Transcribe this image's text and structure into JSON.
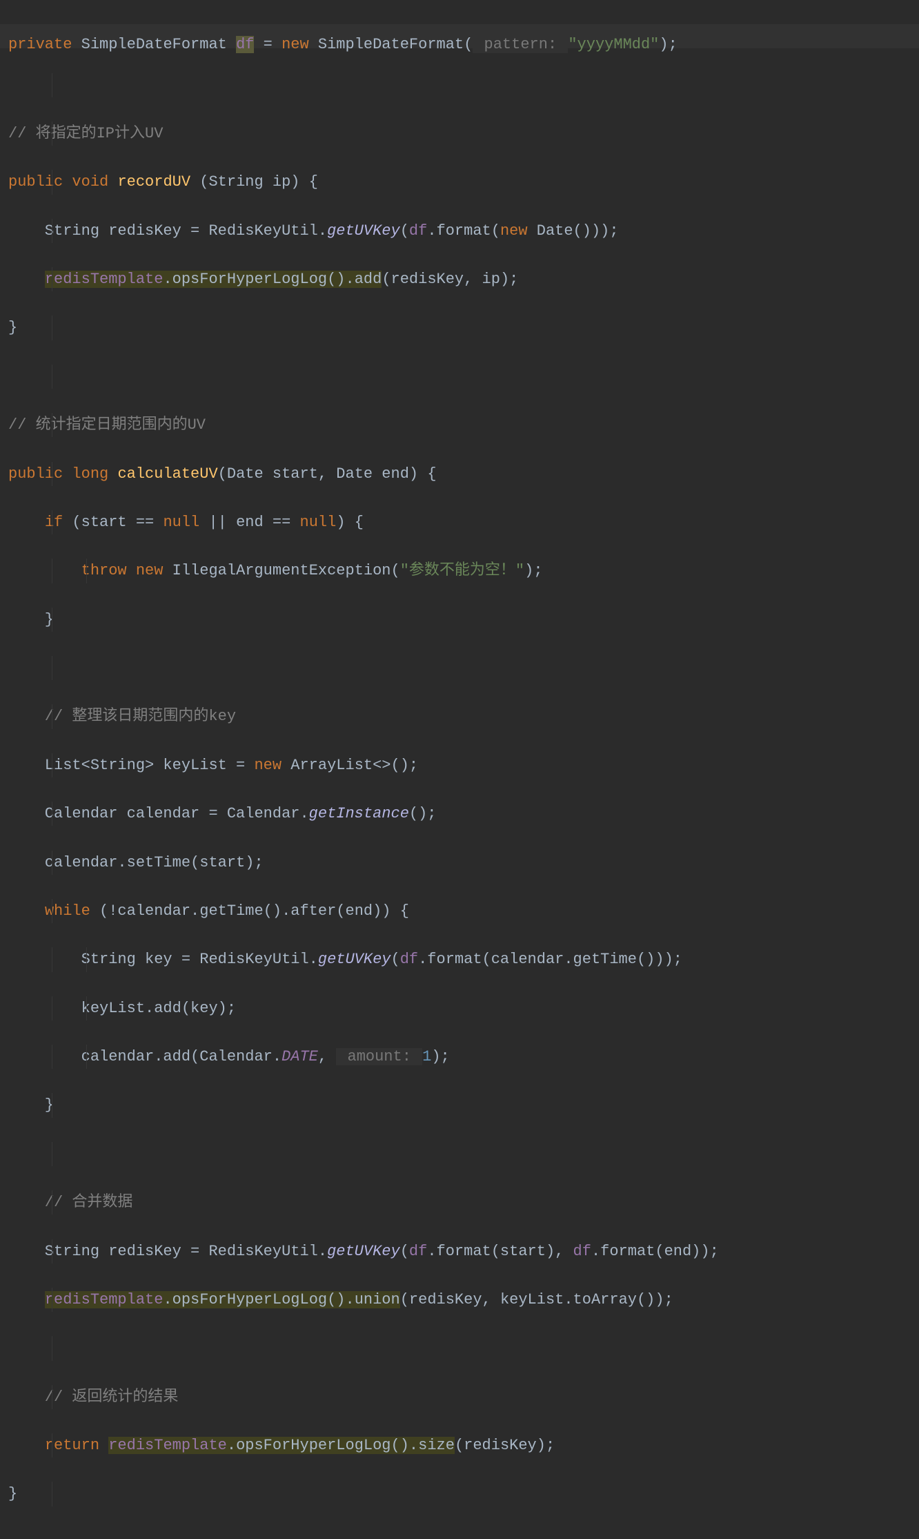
{
  "code": {
    "line1": {
      "kw1": "private",
      "type1": "SimpleDateFormat",
      "field": "df",
      "eq": " = ",
      "kw2": "new",
      "type2": "SimpleDateFormat(",
      "hint": " pattern: ",
      "str": "\"yyyyMMdd\"",
      "end": ");"
    },
    "line3": "// 将指定的IP计入UV",
    "line4": {
      "kw1": "public",
      "kw2": "void",
      "method": "recordUV",
      "params": " (String ip) {"
    },
    "line5": {
      "p1": "    String redisKey = RedisKeyUtil.",
      "m1": "getUVKey",
      "p2": "(",
      "f1": "df",
      "p3": ".format(",
      "kw": "new",
      "p4": " Date()));"
    },
    "line6": {
      "p1": "    ",
      "hl": "redisTemplate",
      "hl2": ".opsForHyperLogLog().add",
      "p2": "(redisKey, ip);"
    },
    "line7": "}",
    "line9": "// 统计指定日期范围内的UV",
    "line10": {
      "kw1": "public",
      "kw2": "long",
      "method": "calculateUV",
      "params": "(Date start, Date end) {"
    },
    "line11": {
      "p1": "    ",
      "kw": "if",
      "p2": " (start == ",
      "null1": "null",
      "p3": " || end == ",
      "null2": "null",
      "p4": ") {"
    },
    "line12": {
      "p1": "        ",
      "kw1": "throw",
      "kw2": "new",
      "p2": " IllegalArgumentException(",
      "str": "\"参数不能为空！\"",
      "p3": ");"
    },
    "line13": "    }",
    "line15": "    // 整理该日期范围内的key",
    "line16": {
      "p1": "    List<String> keyList = ",
      "kw": "new",
      "p2": " ArrayList<>();"
    },
    "line17": {
      "p1": "    Calendar calendar = Calendar.",
      "m": "getInstance",
      "p2": "();"
    },
    "line18": "    calendar.setTime(start);",
    "line19": {
      "p1": "    ",
      "kw": "while",
      "p2": " (!calendar.getTime().after(end)) {"
    },
    "line20": {
      "p1": "        String key = RedisKeyUtil.",
      "m": "getUVKey",
      "p2": "(",
      "f": "df",
      "p3": ".format(calendar.getTime()));"
    },
    "line21": "        keyList.add(key);",
    "line22": {
      "p1": "        calendar.add(Calendar.",
      "c": "DATE",
      "p2": ", ",
      "hint": " amount: ",
      "num": "1",
      "p3": ");"
    },
    "line23": "    }",
    "line25": "    // 合并数据",
    "line26": {
      "p1": "    String redisKey = RedisKeyUtil.",
      "m": "getUVKey",
      "p2": "(",
      "f1": "df",
      "p3": ".format(start), ",
      "f2": "df",
      "p4": ".format(end));"
    },
    "line27": {
      "p1": "    ",
      "hl": "redisTemplate",
      "hl2": ".opsForHyperLogLog().union",
      "p2": "(redisKey, keyList.toArray());"
    },
    "line29": "    // 返回统计的结果",
    "line30": {
      "p1": "    ",
      "kw": "return",
      "p2": " ",
      "hl": "redisTemplate",
      "hl2": ".opsForHyperLogLog().size",
      "p3": "(redisKey);"
    },
    "line31": "}"
  }
}
